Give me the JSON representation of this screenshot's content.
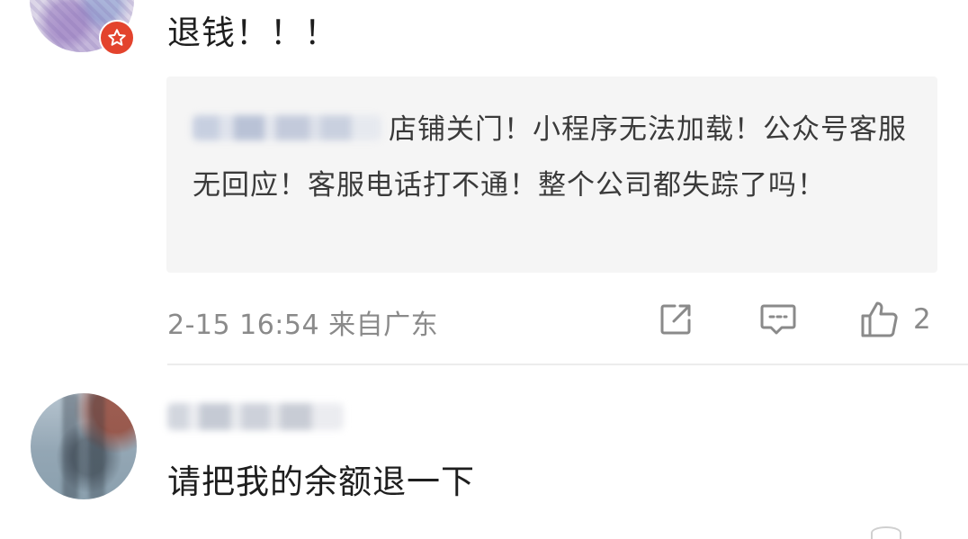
{
  "comment1": {
    "avatar_icon": "user-avatar-icon",
    "badge_icon": "vip-star-icon",
    "badge_color": "#e3432d",
    "text": "退钱！！！",
    "quoted_reply": {
      "text": "店铺关门！小程序无法加载！公众号客服无回应！客服电话打不通！整个公司都失踪了吗！"
    },
    "meta": "2-15 16:54 来自广东",
    "actions": {
      "share_icon": "share-icon",
      "reply_icon": "comment-icon",
      "like_icon": "thumbs-up-icon",
      "like_count": "2"
    }
  },
  "comment2": {
    "avatar_icon": "user-avatar-icon",
    "text": "请把我的余额退一下"
  },
  "colors": {
    "text_primary": "#1e1e1e",
    "text_secondary": "#8a8a8a",
    "quote_bg": "#f5f5f5",
    "divider": "#ececec"
  }
}
